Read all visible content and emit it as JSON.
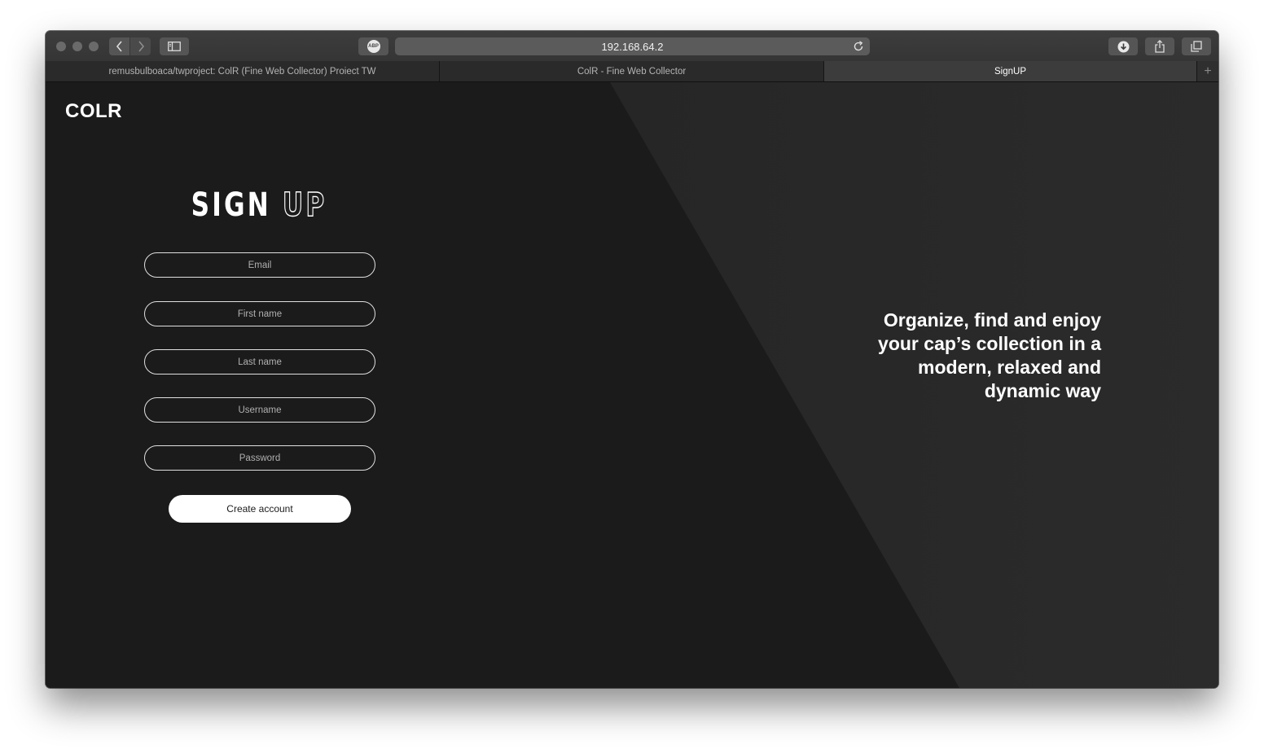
{
  "browser": {
    "url": "192.168.64.2",
    "adblock_label": "ABP",
    "tabs": [
      {
        "title": "remusbulboaca/twproject: ColR (Fine Web Collector) Proiect TW",
        "active": false
      },
      {
        "title": "ColR - Fine Web Collector",
        "active": false
      },
      {
        "title": "SignUP",
        "active": true
      }
    ],
    "new_tab_label": "+"
  },
  "page": {
    "logo": "COLR",
    "heading_solid": "SIGN",
    "heading_outline": "UP",
    "form": {
      "email_placeholder": "Email",
      "first_name_placeholder": "First name",
      "last_name_placeholder": "Last name",
      "username_placeholder": "Username",
      "password_placeholder": "Password",
      "submit_label": "Create account"
    },
    "tagline": "Organize, find and enjoy your cap’s collection in a modern, relaxed and dynamic way"
  },
  "colors": {
    "page_background": "#1b1b1b",
    "diagonal_panel": "#282828",
    "button_background": "#ffffff"
  }
}
